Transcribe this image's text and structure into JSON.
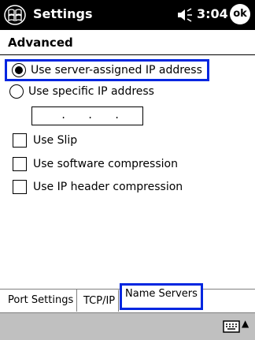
{
  "titlebar": {
    "app_title": "Settings",
    "time": "3:04",
    "ok_label": "ok"
  },
  "page": {
    "heading": "Advanced"
  },
  "options": {
    "server_ip_label": "Use server-assigned IP address",
    "server_ip_selected": true,
    "specific_ip_label": "Use specific IP address",
    "specific_ip_selected": false,
    "ip_value": "",
    "use_slip_label": "Use Slip",
    "use_slip_checked": false,
    "software_compression_label": "Use software compression",
    "software_compression_checked": false,
    "ip_header_compression_label": "Use IP header compression",
    "ip_header_compression_checked": false
  },
  "tabs": [
    {
      "label": "Port Settings"
    },
    {
      "label": "TCP/IP"
    },
    {
      "label": "Name Servers"
    }
  ],
  "active_tab": "TCP/IP",
  "highlight_color": "#0026e0",
  "icons": {
    "start": "windows-flag-icon",
    "volume": "speaker-icon",
    "keyboard": "keyboard-icon",
    "arrow": "up-arrow-icon"
  }
}
